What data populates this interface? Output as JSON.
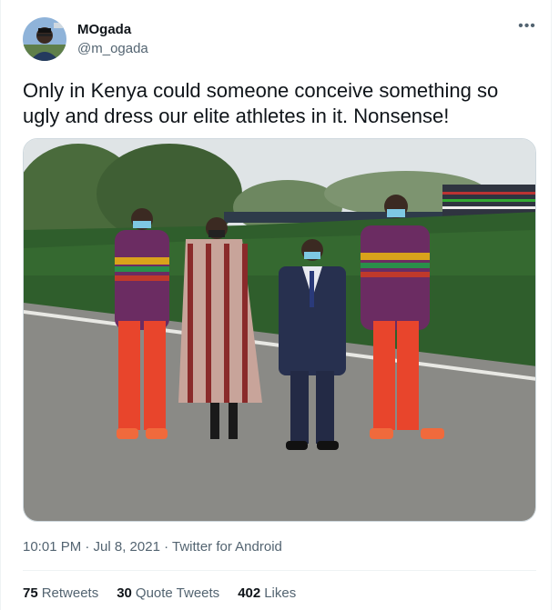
{
  "author": {
    "display_name": "MOgada",
    "handle": "@m_ogada",
    "avatar_icon": "user-avatar-icon"
  },
  "more_icon": "more-dots-icon",
  "tweet": {
    "text": "Only in Kenya could someone conceive something so ugly and dress our elite athletes in it. Nonsense!",
    "timestamp": "10:01 PM · Jul 8, 2021 · Twitter for Android"
  },
  "stats": {
    "retweets_count": "75",
    "retweets_label": "Retweets",
    "quotes_count": "30",
    "quotes_label": "Quote Tweets",
    "likes_count": "402",
    "likes_label": "Likes"
  },
  "colors": {
    "text_primary": "#0f1419",
    "text_secondary": "#536471",
    "divider": "#eff3f4"
  }
}
